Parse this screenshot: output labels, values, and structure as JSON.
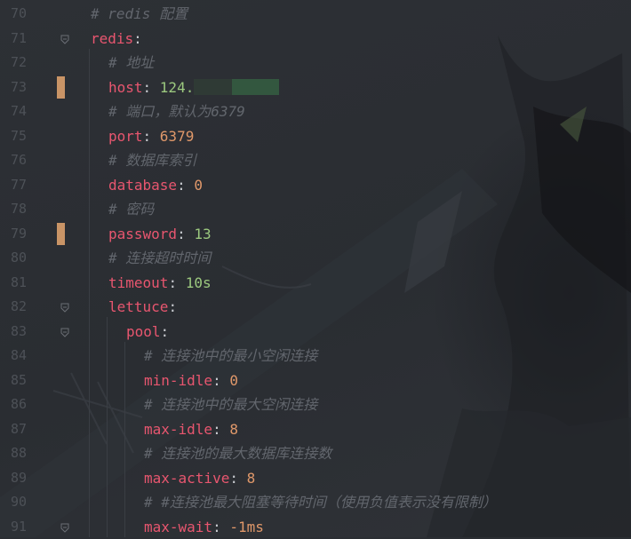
{
  "lines": [
    {
      "no": "70",
      "indent": 0,
      "kind": "comment",
      "text": "# redis 配置"
    },
    {
      "no": "71",
      "indent": 0,
      "kind": "key",
      "key": "redis",
      "fold": true
    },
    {
      "no": "72",
      "indent": 1,
      "kind": "comment",
      "text": "# 地址"
    },
    {
      "no": "73",
      "indent": 1,
      "kind": "kv",
      "key": "host",
      "value": "124.",
      "value_type": "str",
      "mark": true,
      "masked": true
    },
    {
      "no": "74",
      "indent": 1,
      "kind": "comment",
      "text": "# 端口，默认为6379"
    },
    {
      "no": "75",
      "indent": 1,
      "kind": "kv",
      "key": "port",
      "value": "6379",
      "value_type": "num"
    },
    {
      "no": "76",
      "indent": 1,
      "kind": "comment",
      "text": "# 数据库索引"
    },
    {
      "no": "77",
      "indent": 1,
      "kind": "kv",
      "key": "database",
      "value": "0",
      "value_type": "num"
    },
    {
      "no": "78",
      "indent": 1,
      "kind": "comment",
      "text": "# 密码"
    },
    {
      "no": "79",
      "indent": 1,
      "kind": "kv",
      "key": "password",
      "value": "13",
      "value_type": "str",
      "mark": true
    },
    {
      "no": "80",
      "indent": 1,
      "kind": "comment",
      "text": "# 连接超时时间"
    },
    {
      "no": "81",
      "indent": 1,
      "kind": "kv",
      "key": "timeout",
      "value": "10s",
      "value_type": "str"
    },
    {
      "no": "82",
      "indent": 1,
      "kind": "key",
      "key": "lettuce",
      "fold": true
    },
    {
      "no": "83",
      "indent": 2,
      "kind": "key",
      "key": "pool",
      "fold": true
    },
    {
      "no": "84",
      "indent": 3,
      "kind": "comment",
      "text": "# 连接池中的最小空闲连接"
    },
    {
      "no": "85",
      "indent": 3,
      "kind": "kv",
      "key": "min-idle",
      "value": "0",
      "value_type": "num"
    },
    {
      "no": "86",
      "indent": 3,
      "kind": "comment",
      "text": "# 连接池中的最大空闲连接"
    },
    {
      "no": "87",
      "indent": 3,
      "kind": "kv",
      "key": "max-idle",
      "value": "8",
      "value_type": "num"
    },
    {
      "no": "88",
      "indent": 3,
      "kind": "comment",
      "text": "# 连接池的最大数据库连接数"
    },
    {
      "no": "89",
      "indent": 3,
      "kind": "kv",
      "key": "max-active",
      "value": "8",
      "value_type": "num"
    },
    {
      "no": "90",
      "indent": 3,
      "kind": "comment",
      "text": "# #连接池最大阻塞等待时间（使用负值表示没有限制）"
    },
    {
      "no": "91",
      "indent": 3,
      "kind": "kv",
      "key": "max-wait",
      "value": "-1ms",
      "value_type": "num",
      "fold": true
    }
  ],
  "colors": {
    "background": "#2b2e33",
    "line_number": "#4d5157",
    "comment": "#62666d",
    "key": "#e8566f",
    "number": "#e0986a",
    "string": "#9cc97f",
    "change_marker": "#c99466"
  },
  "icons": {
    "fold": "fold-marker-icon"
  }
}
